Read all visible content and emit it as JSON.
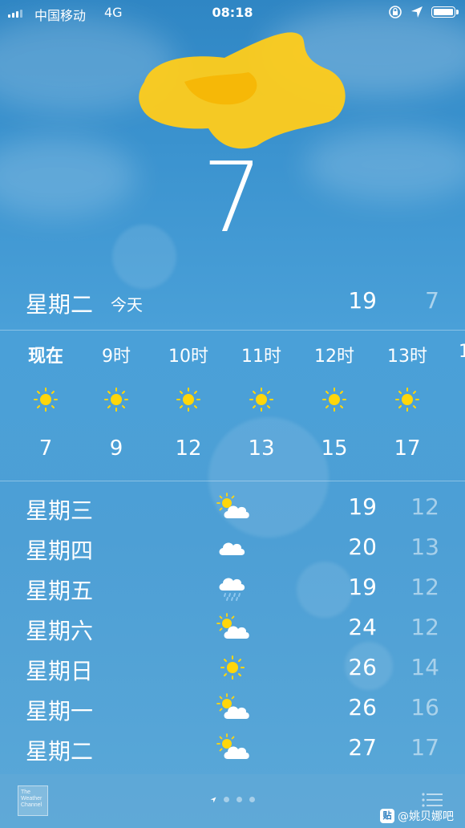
{
  "status_bar": {
    "carrier": "中国移动",
    "network": "4G",
    "time": "08:18"
  },
  "current": {
    "temperature": "7"
  },
  "today": {
    "day": "星期二",
    "tag": "今天",
    "high": "19",
    "low": "7"
  },
  "hourly": [
    {
      "label": "现在",
      "icon": "sun-icon",
      "temp": "7"
    },
    {
      "label": "9时",
      "icon": "sun-icon",
      "temp": "9"
    },
    {
      "label": "10时",
      "icon": "sun-icon",
      "temp": "12"
    },
    {
      "label": "11时",
      "icon": "sun-icon",
      "temp": "13"
    },
    {
      "label": "12时",
      "icon": "sun-icon",
      "temp": "15"
    },
    {
      "label": "13时",
      "icon": "sun-icon",
      "temp": "17"
    },
    {
      "label": "1",
      "icon": "",
      "temp": ""
    }
  ],
  "daily": [
    {
      "day": "星期三",
      "icon": "partly-cloudy-icon",
      "high": "19",
      "low": "12"
    },
    {
      "day": "星期四",
      "icon": "cloud-icon",
      "high": "20",
      "low": "13"
    },
    {
      "day": "星期五",
      "icon": "rain-cloud-icon",
      "high": "19",
      "low": "12"
    },
    {
      "day": "星期六",
      "icon": "partly-cloudy-icon",
      "high": "24",
      "low": "12"
    },
    {
      "day": "星期日",
      "icon": "sun-icon",
      "high": "26",
      "low": "14"
    },
    {
      "day": "星期一",
      "icon": "partly-cloudy-icon",
      "high": "26",
      "low": "16"
    },
    {
      "day": "星期二",
      "icon": "partly-cloudy-icon",
      "high": "27",
      "low": "17"
    }
  ],
  "bottom_bar": {
    "logo_text": "The Weather Channel",
    "watermark_badge": "贴",
    "watermark": "@姚贝娜吧"
  },
  "colors": {
    "sun": "#ffd60a",
    "blot": "#ffcc1a"
  }
}
